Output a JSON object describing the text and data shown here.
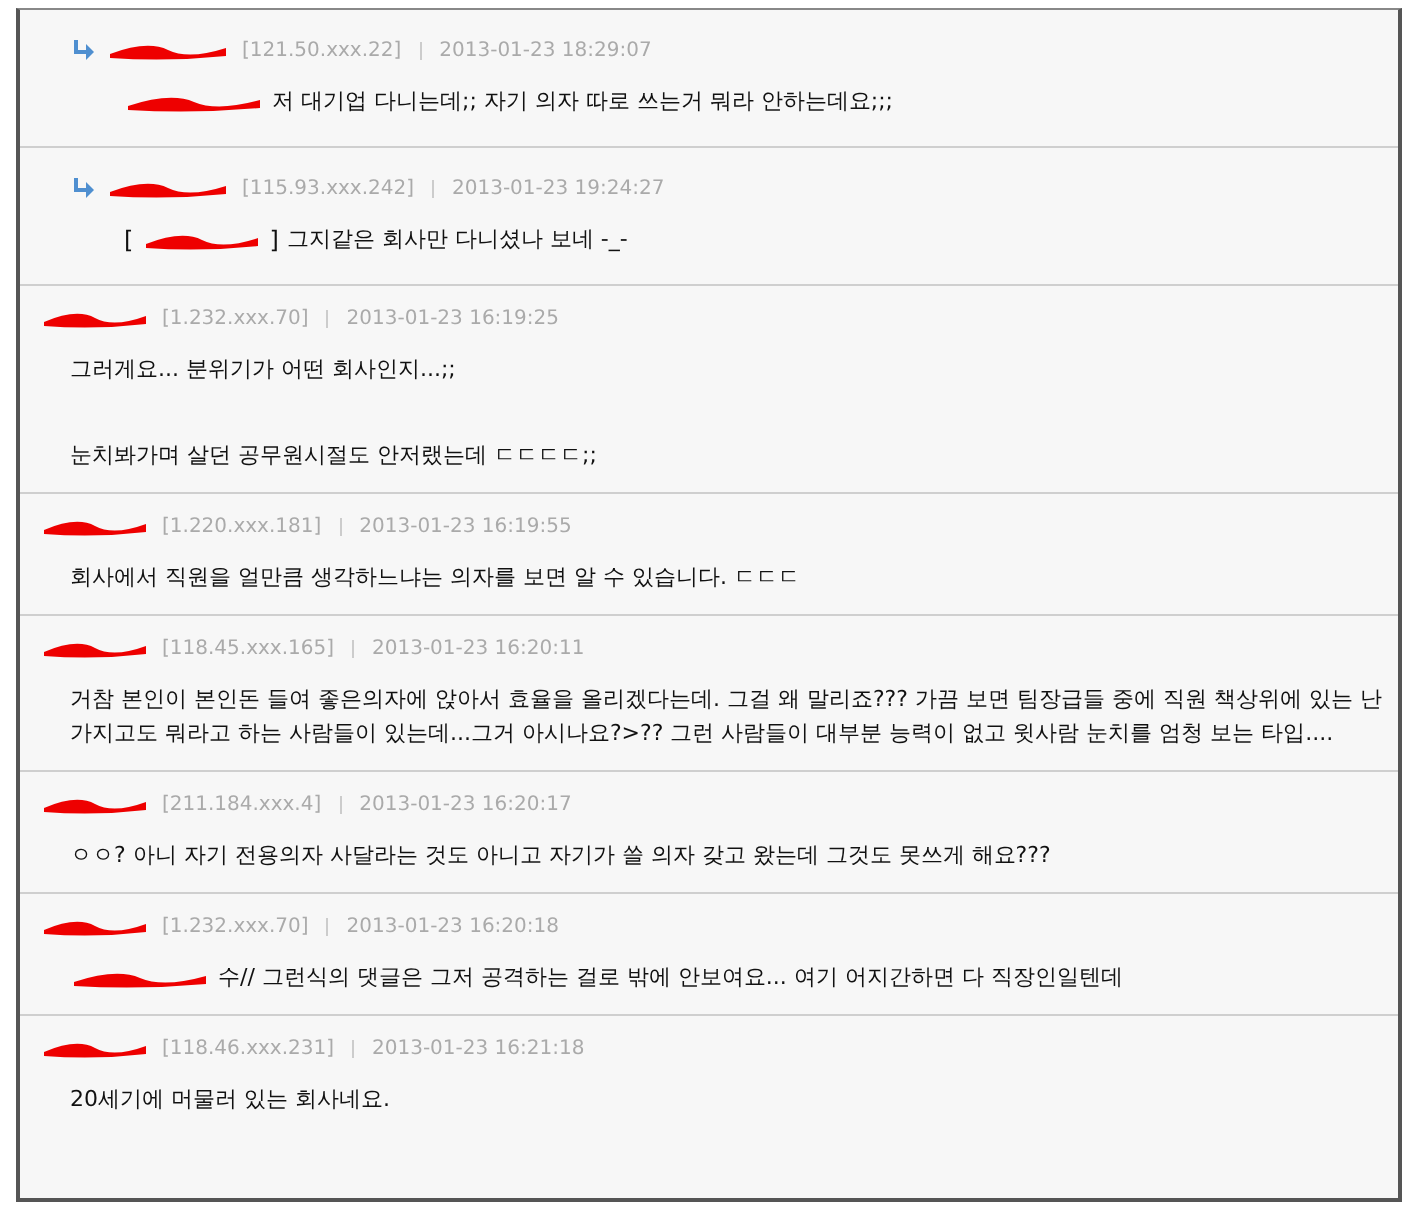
{
  "comments": [
    {
      "kind": "reply",
      "ip": "[121.50.xxx.22]",
      "time": "2013-01-23 18:29:07",
      "mention": true,
      "paragraphs": [
        "저 대기업 다니는데;; 자기 의자 따로 쓰는거 뭐라 안하는데요;;;"
      ]
    },
    {
      "kind": "reply",
      "ip": "[115.93.xxx.242]",
      "time": "2013-01-23 19:24:27",
      "mention": true,
      "mention_open": "[",
      "mention_close": "]",
      "paragraphs": [
        "그지같은 회사만 다니셨나 보네 -_-"
      ]
    },
    {
      "kind": "comment",
      "ip": "[1.232.xxx.70]",
      "time": "2013-01-23 16:19:25",
      "mention": false,
      "paragraphs": [
        "그러게요... 분위기가 어떤 회사인지...;;",
        "눈치봐가며 살던 공무원시절도 안저랬는데 ㄷㄷㄷㄷ;;"
      ]
    },
    {
      "kind": "comment",
      "ip": "[1.220.xxx.181]",
      "time": "2013-01-23 16:19:55",
      "mention": false,
      "paragraphs": [
        "회사에서 직원을 얼만큼 생각하느냐는 의자를 보면 알 수 있습니다. ㄷㄷㄷ"
      ]
    },
    {
      "kind": "comment",
      "ip": "[118.45.xxx.165]",
      "time": "2013-01-23 16:20:11",
      "mention": false,
      "paragraphs": [
        "거참 본인이 본인돈 들여 좋은의자에 앉아서 효율을 올리겠다는데. 그걸 왜 말리죠??? 가끔 보면 팀장급들 중에 직원 책상위에 있는 난가지고도 뭐라고 하는 사람들이 있는데...그거 아시나요?>?? 그런 사람들이 대부분 능력이 없고 윗사람 눈치를 엄청 보는 타입...."
      ]
    },
    {
      "kind": "comment",
      "ip": "[211.184.xxx.4]",
      "time": "2013-01-23 16:20:17",
      "mention": false,
      "paragraphs": [
        "ㅇㅇ? 아니 자기 전용의자 사달라는 것도 아니고 자기가 쓸 의자 갖고 왔는데 그것도 못쓰게 해요???"
      ]
    },
    {
      "kind": "comment",
      "ip": "[1.232.xxx.70]",
      "time": "2013-01-23 16:20:18",
      "mention": true,
      "paragraphs": [
        "수// 그런식의 댓글은 그저 공격하는 걸로 밖에 안보여요... 여기 어지간하면 다 직장인일텐데"
      ]
    },
    {
      "kind": "comment",
      "ip": "[118.46.xxx.231]",
      "time": "2013-01-23 16:21:18",
      "mention": false,
      "paragraphs": [
        "20세기에 머물러 있는 회사네요."
      ]
    }
  ]
}
